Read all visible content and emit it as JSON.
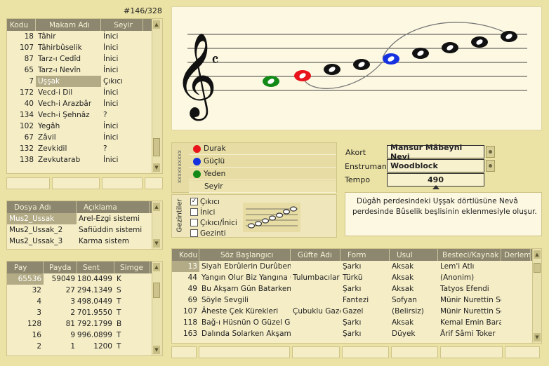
{
  "counter": "#146/328",
  "makam": {
    "columns": [
      "Kodu",
      "Makam Adı",
      "Seyir"
    ],
    "rows": [
      [
        "18",
        "Tâhir",
        "İnici"
      ],
      [
        "107",
        "Tâhirbûselik",
        "İnici"
      ],
      [
        "87",
        "Tarz-ı Cedîd",
        "İnici"
      ],
      [
        "65",
        "Tarz-ı Nevîn",
        "İnici"
      ],
      [
        "7",
        "Uşşak",
        "Çıkıcı"
      ],
      [
        "172",
        "Vecd-i Dil",
        "İnici"
      ],
      [
        "40",
        "Vech-i Arazbâr",
        "İnici"
      ],
      [
        "134",
        "Vech-i Şehnâz",
        "?"
      ],
      [
        "102",
        "Yegâh",
        "İnici"
      ],
      [
        "67",
        "Zâvil",
        "İnici"
      ],
      [
        "132",
        "Zevkidil",
        "?"
      ],
      [
        "138",
        "Zevkutarab",
        "İnici"
      ]
    ]
  },
  "dosya": {
    "columns": [
      "Dosya Adı",
      "Açıklama"
    ],
    "rows": [
      [
        "Mus2_Ussak",
        "Arel-Ezgi sistemi"
      ],
      [
        "Mus2_Ussak_2",
        "Safiüddin sistemi"
      ],
      [
        "Mus2_Ussak_3",
        "Karma sistem"
      ]
    ]
  },
  "ratios": {
    "columns": [
      "Pay",
      "Payda",
      "Sent",
      "Simge"
    ],
    "rows": [
      [
        "65536",
        "59049",
        "180.4499",
        "K"
      ],
      [
        "32",
        "27",
        "294.1349",
        "S"
      ],
      [
        "4",
        "3",
        "498.0449",
        "T"
      ],
      [
        "3",
        "2",
        "701.9550",
        "T"
      ],
      [
        "128",
        "81",
        "792.1799",
        "B"
      ],
      [
        "16",
        "9",
        "996.0899",
        "T"
      ],
      [
        "2",
        "1",
        "1200",
        "T"
      ]
    ]
  },
  "legend": {
    "side_label": "xxxxxxxxxx",
    "items": [
      {
        "label": "Durak",
        "color": "#e8131b"
      },
      {
        "label": "Güçlü",
        "color": "#1632e0"
      },
      {
        "label": "Yeden",
        "color": "#138a18"
      },
      {
        "label": "Seyir",
        "color": ""
      }
    ]
  },
  "gezintiler": {
    "side_label": "Gezintiler",
    "items": [
      {
        "label": "Çıkıcı",
        "checked": true
      },
      {
        "label": "İnici",
        "checked": false
      },
      {
        "label": "Çıkıcı/İnici",
        "checked": false
      },
      {
        "label": "Gezinti",
        "checked": false
      }
    ]
  },
  "settings": {
    "akort_label": "Akort",
    "akort_value": "Mansur Mâbeyni Neyi",
    "enstruman_label": "Enstruman",
    "enstruman_value": "Woodblock",
    "tempo_label": "Tempo",
    "tempo_value": "490"
  },
  "description": "Dügâh perdesindeki Uşşak dörtlüsüne Nevâ perdesinde Bûselik beşlisinin eklenmesiyle oluşur.",
  "songs": {
    "columns": [
      "Kodu",
      "Söz Başlangıcı",
      "Güfte Adı",
      "Form",
      "Usul",
      "Besteci/Kaynak Ki",
      "Derlem"
    ],
    "rows": [
      [
        "13",
        "Siyah Ebrûlerin Durûben Ç",
        "",
        "Şarkı",
        "Aksak",
        "Lem'i Atlı",
        ""
      ],
      [
        "44",
        "Yangın Olur Biz Yangına Gi",
        "Tulumbacılar",
        "Türkü",
        "Aksak",
        "(Anonim)",
        ""
      ],
      [
        "49",
        "Bu Akşam Gün Batarken Ge",
        "",
        "Şarkı",
        "Aksak",
        "Tatyos Efendi",
        ""
      ],
      [
        "69",
        "Söyle Sevgili",
        "",
        "Fantezi",
        "Sofyan",
        "Münir Nurettin Sel",
        ""
      ],
      [
        "107",
        "Âheste Çek Kürekleri",
        "Çubuklu Gaze",
        "Gazel",
        "(Belirsiz)",
        "Münir Nurettin Sel",
        ""
      ],
      [
        "118",
        "Bağ-ı Hüsnün O Güzel Gülle",
        "",
        "Şarkı",
        "Aksak",
        "Kemal Emin Bara",
        ""
      ],
      [
        "163",
        "Dalında Solarken Akşamın",
        "",
        "Şarkı",
        "Düyek",
        "Ârif Sâmi Toker",
        ""
      ]
    ]
  }
}
